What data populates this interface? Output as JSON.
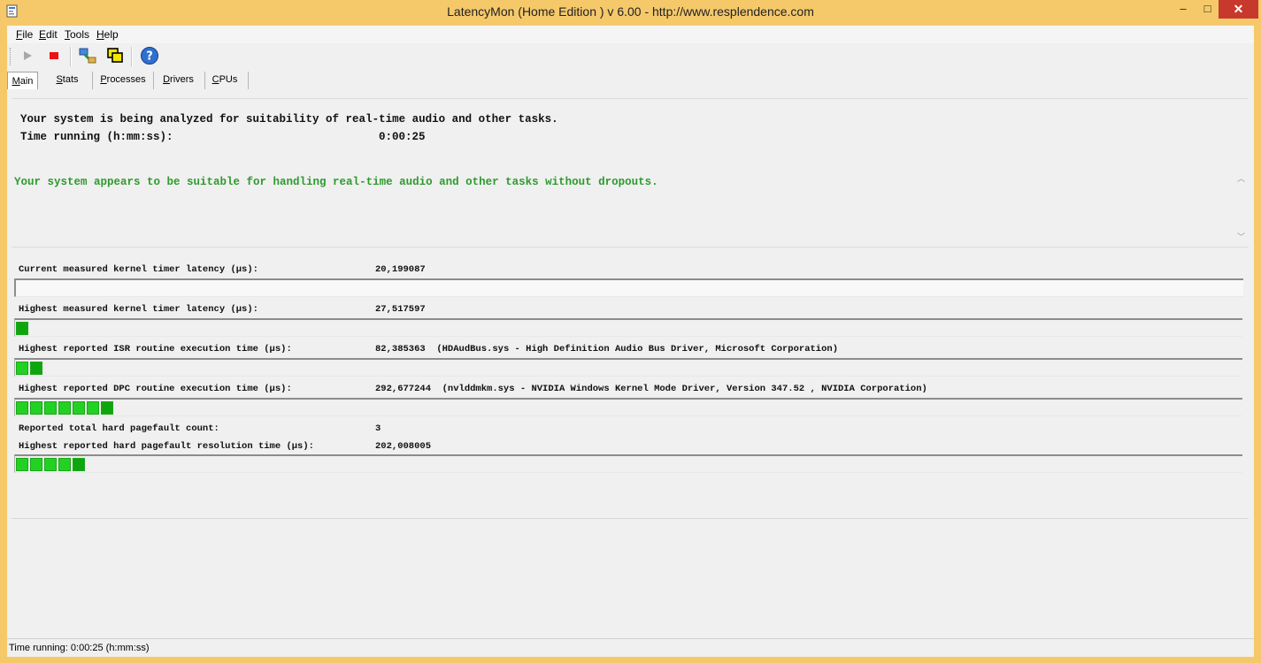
{
  "window": {
    "title": "LatencyMon  (Home Edition )  v 6.00 - http://www.resplendence.com",
    "minimize": "–",
    "maximize": "□",
    "close": "✕"
  },
  "menu": [
    {
      "label": "File"
    },
    {
      "label": "Edit"
    },
    {
      "label": "Tools"
    },
    {
      "label": "Help"
    }
  ],
  "toolbar": {
    "icons": [
      "play-icon",
      "stop-icon",
      "process-tree-icon",
      "windows-icon",
      "help-icon"
    ]
  },
  "tabs": [
    {
      "label": "Main",
      "selected": true
    },
    {
      "label": "Stats"
    },
    {
      "label": "Processes"
    },
    {
      "label": "Drivers"
    },
    {
      "label": "CPUs"
    }
  ],
  "status": {
    "analysis_text": "Your system is being analyzed for suitability of real-time audio and other tasks.",
    "time_label": "Time running (h:mm:ss):",
    "time_value": "0:00:25"
  },
  "verdict": {
    "text": "Your system appears to be suitable for handling real-time audio and other tasks without dropouts.",
    "color": "#2e9a2e"
  },
  "metrics": [
    {
      "label": "Current measured kernel timer latency (µs):",
      "value": "20,199087",
      "bar_segments": 0
    },
    {
      "label": "Highest measured kernel timer latency (µs):",
      "value": "27,517597",
      "bar_segments": 1
    },
    {
      "label": "Highest reported ISR routine execution time (µs):",
      "value": "82,385363",
      "detail": "(HDAudBus.sys - High Definition Audio Bus Driver, Microsoft Corporation)",
      "bar_segments": 2
    },
    {
      "label": "Highest reported DPC routine execution time (µs):",
      "value": "292,677244",
      "detail": "(nvlddmkm.sys - NVIDIA Windows Kernel Mode Driver, Version 347.52 , NVIDIA Corporation)",
      "bar_segments": 7
    },
    {
      "label": "Reported total hard pagefault count:",
      "value": "3"
    },
    {
      "label": "Highest reported hard pagefault resolution time (µs):",
      "value": "202,008005",
      "bar_segments": 5
    }
  ],
  "statusbar": {
    "text": "Time running: 0:00:25  (h:mm:ss)"
  },
  "colors": {
    "title_bar": "#f5c96a",
    "close_button": "#c7392d",
    "bar_green": "#23d123",
    "bar_green_dark": "#0fa50f"
  }
}
